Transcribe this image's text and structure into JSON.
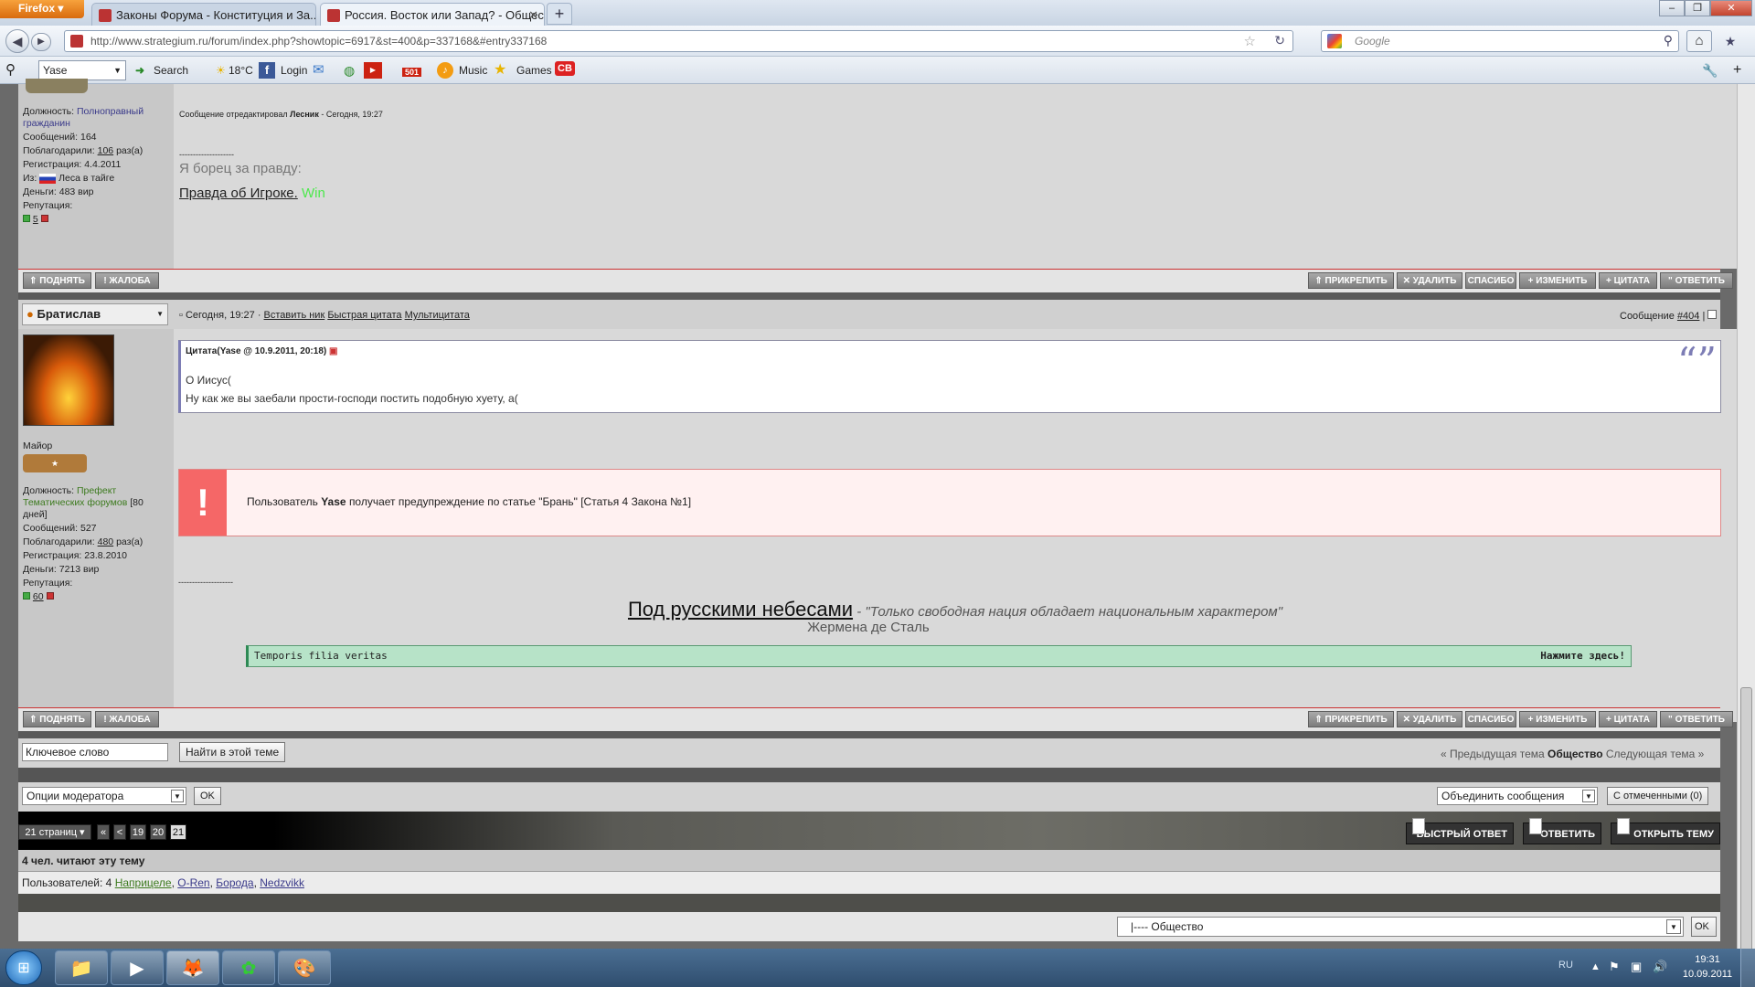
{
  "browser": {
    "app_button": "Firefox",
    "tabs": [
      {
        "label": "Законы Форума - Конституция и За..."
      },
      {
        "label": "Россия. Восток или Запад? - Общес..."
      }
    ],
    "url": "http://www.strategium.ru/forum/index.php?showtopic=6917&st=400&p=337168&#entry337168",
    "search_placeholder": "Google",
    "toolbar": {
      "profile": "Yase",
      "search": "Search",
      "weather": "18°C",
      "login": "Login",
      "badge": "501",
      "music": "Music",
      "games": "Games",
      "cb": "CB"
    }
  },
  "post1": {
    "role_label": "Должность:",
    "role_value": "Полноправный гражданин",
    "messages": "Сообщений: 164",
    "thanks_prefix": "Поблагодарили:",
    "thanks_count": "106",
    "thanks_suffix": "раз(а)",
    "reg": "Регистрация: 4.4.2011",
    "from_prefix": "Из:",
    "from_value": "Леса в тайге",
    "money": "Деньги: 483 вир",
    "rep_label": "Репутация:",
    "rep_value": "5",
    "edited_prefix": "Сообщение отредактировал",
    "edited_by": "Лесник",
    "edited_time": "- Сегодня, 19:27",
    "sig_line": "--------------------",
    "sig_text": "Я борец за правду:",
    "sig_link": "Правда об Игроке.",
    "sig_win": "Win"
  },
  "buttons": {
    "up": "ПОДНЯТЬ",
    "report": "ЖАЛОБА",
    "pin": "ПРИКРЕПИТЬ",
    "delete": "УДАЛИТЬ",
    "thanks": "СПАСИБО",
    "edit": "ИЗМЕНИТЬ",
    "quote": "ЦИТАТА",
    "reply": "ОТВЕТИТЬ"
  },
  "post2": {
    "author": "Братислав",
    "time": "Сегодня, 19:27",
    "insert_nick": "Вставить ник",
    "quick_quote": "Быстрая цитата",
    "multiquote": "Мультицитата",
    "msg_prefix": "Сообщение",
    "msg_num": "#404",
    "rank": "Майор",
    "role_label": "Должность:",
    "role_value": "Префект Тематических форумов",
    "role_days": "[80 дней]",
    "messages": "Сообщений: 527",
    "thanks_prefix": "Поблагодарили:",
    "thanks_count": "480",
    "thanks_suffix": "раз(а)",
    "reg": "Регистрация: 23.8.2010",
    "money": "Деньги: 7213 вир",
    "rep_label": "Репутация:",
    "rep_value": "60",
    "quote_header": "Цитата(Yase @ 10.9.2011, 20:18)",
    "quote_line1": "О Иисус(",
    "quote_line2": "Ну как же вы заебали прости-господи постить подобную хуету, а(",
    "warn_prefix": "Пользователь",
    "warn_user": "Yase",
    "warn_text": "получает предупреждение по статье \"Брань\" [Статья 4 Закона №1]",
    "sig_line": "--------------------",
    "sig_title": "Под русскими небесами",
    "sig_quote": "- \"Только свободная нация обладает национальным характером\"",
    "sig_author": "Жермена де Сталь",
    "spoiler_text": "Temporis filia veritas",
    "spoiler_btn": "Нажмите здесь!"
  },
  "footer": {
    "keyword_placeholder": "Ключевое слово",
    "search_btn": "Найти в этой теме",
    "prev_topic": "« Предыдущая тема",
    "forum_name": "Общество",
    "next_topic": "Следующая тема »",
    "mod_options": "Опции модератора",
    "ok": "OK",
    "merge": "Объединить сообщения",
    "selected": "С отмеченными (0)",
    "pages": "21 страниц",
    "first": "«",
    "prev": "<",
    "p19": "19",
    "p20": "20",
    "p21": "21",
    "quick_reply": "БЫСТРЫЙ ОТВЕТ",
    "reply": "ОТВЕТИТЬ",
    "new_topic": "ОТКРЫТЬ ТЕМУ",
    "readers_title": "4 чел. читают эту тему",
    "readers_prefix": "Пользователей: 4",
    "readers": [
      "Наприцеле",
      "O-Ren",
      "Борода",
      "Nedzvikk"
    ],
    "jump": "|---- Общество"
  },
  "taskbar": {
    "lang": "RU",
    "time": "19:31",
    "date": "10.09.2011"
  }
}
